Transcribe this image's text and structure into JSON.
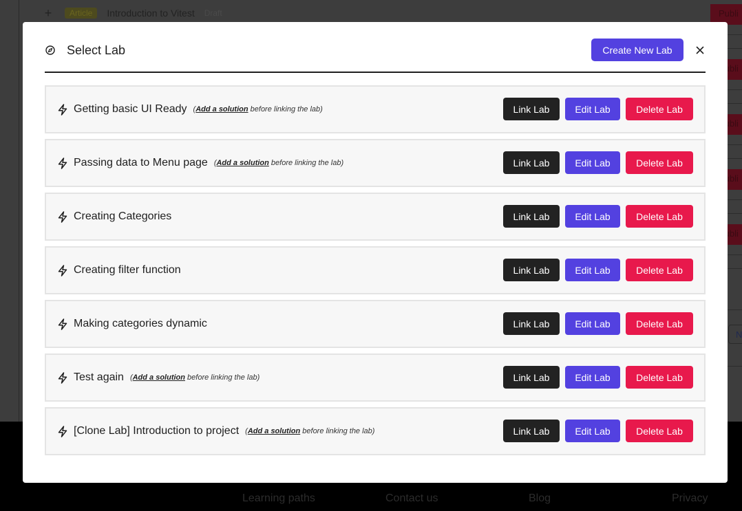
{
  "background": {
    "row": {
      "badge": "Article",
      "title": "Introduction to Vitest",
      "status": "Draft"
    },
    "publish_label": "Publi",
    "pill_label": "N",
    "footer_links": [
      "Learning paths",
      "Contact us",
      "Blog",
      "Privacy"
    ]
  },
  "modal": {
    "title": "Select Lab",
    "title_icon": "compass-icon",
    "create_label": "Create New Lab",
    "close_label": "×"
  },
  "labs": [
    {
      "name": "Getting basic UI Ready",
      "note_link": "Add a solution",
      "note_text": " before linking the lab"
    },
    {
      "name": "Passing data to Menu page",
      "note_link": "Add a solution",
      "note_text": " before linking the lab"
    },
    {
      "name": "Creating Categories"
    },
    {
      "name": "Creating filter function"
    },
    {
      "name": "Making categories dynamic"
    },
    {
      "name": "Test again",
      "note_link": "Add a solution",
      "note_text": " before linking the lab"
    },
    {
      "name": "[Clone Lab] Introduction to project",
      "note_link": "Add a solution",
      "note_text": " before linking the lab"
    }
  ],
  "actions": {
    "link": "Link Lab",
    "edit": "Edit Lab",
    "delete": "Delete Lab"
  },
  "colors": {
    "accent": "#5341e0",
    "danger": "#e8194c",
    "dark": "#222222"
  }
}
